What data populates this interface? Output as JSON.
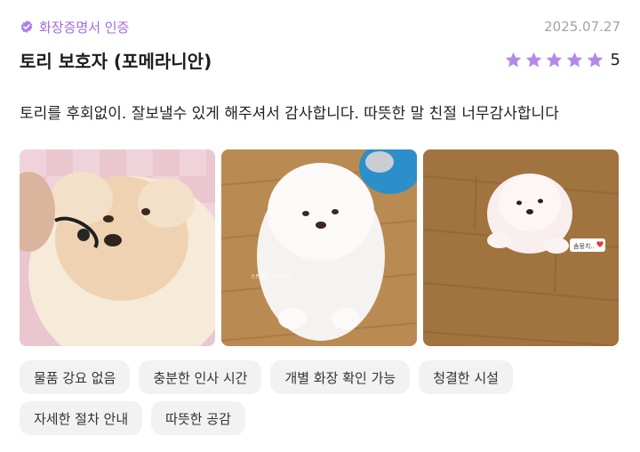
{
  "review": {
    "badge_label": "화장증명서 인증",
    "date": "2025.07.27",
    "title": "토리 보호자 (포메라니안)",
    "rating": 5,
    "rating_label": "5",
    "text": "토리를 후회없이. 잘보낼수 있게 해주셔서 감사합니다. 따뜻한 말 친절 너무감사합니다"
  },
  "photos": [
    {
      "caption": ""
    },
    {
      "caption": "스트레스 캐치인다"
    },
    {
      "caption": "솜뭉치.."
    }
  ],
  "tags": [
    "물품 강요 없음",
    "충분한 인사 시간",
    "개별 화장 확인 가능",
    "청결한 시설",
    "자세한 절차 안내",
    "따뜻한 공감"
  ],
  "colors": {
    "accent": "#a66bdf",
    "star": "#b38ae6",
    "tag_bg": "#f2f2f2",
    "muted": "#a3a3a3"
  }
}
